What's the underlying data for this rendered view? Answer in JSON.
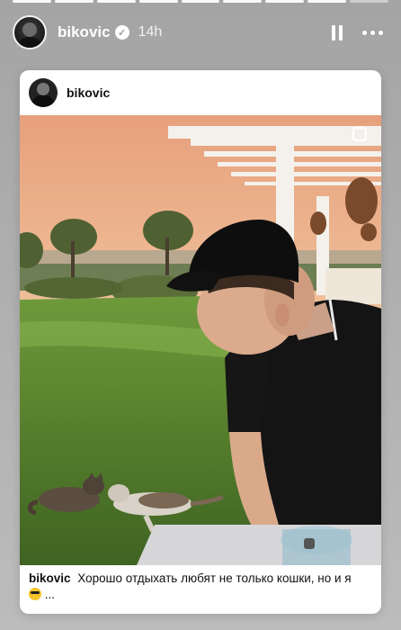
{
  "story": {
    "username": "bikovic",
    "verified_icon": "✓",
    "time": "14h",
    "segments": [
      1,
      1,
      1,
      1,
      1,
      1,
      1,
      1,
      0
    ],
    "pause_icon": "pause-icon",
    "more_icon": "more-options-icon"
  },
  "post": {
    "username": "bikovic",
    "caption_user": "bikovic",
    "caption_text": "Хорошо отдыхать любят не только кошки, но и я",
    "caption_emoji": "😎",
    "caption_ellipsis": "..."
  },
  "colors": {
    "story_background": "#b0b0b0",
    "card": "#ffffff",
    "text": "#111111"
  }
}
